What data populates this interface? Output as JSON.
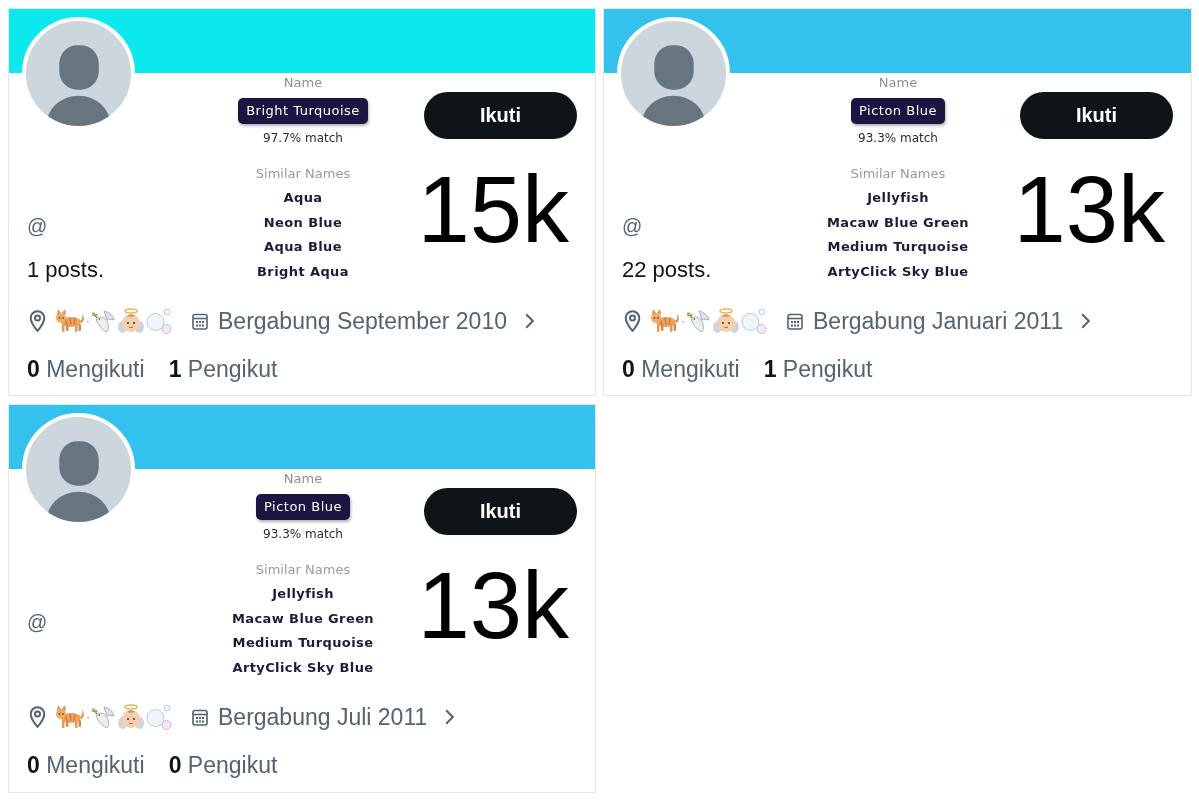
{
  "profiles": [
    {
      "color": "#0be9ef",
      "color_match": {
        "label": "Name",
        "name": "Bright Turquoise",
        "match": "97.7% match",
        "similar_label": "Similar Names",
        "similar": [
          "Aqua",
          "Neon Blue",
          "Aqua Blue",
          "Bright Aqua"
        ]
      },
      "follow_button": "Ikuti",
      "big_number": "15k",
      "handle": "@",
      "posts": "1 posts.",
      "location": {
        "separator": "·"
      },
      "joined": "Bergabung September 2010",
      "following": {
        "count": "0",
        "label": "Mengikuti"
      },
      "followers": {
        "count": "1",
        "label": "Pengikut"
      }
    },
    {
      "color": "#33c1ee",
      "color_match": {
        "label": "Name",
        "name": "Picton Blue",
        "match": "93.3% match",
        "similar_label": "Similar Names",
        "similar": [
          "Jellyfish",
          "Macaw Blue Green",
          "Medium Turquoise",
          "ArtyClick Sky Blue"
        ]
      },
      "follow_button": "Ikuti",
      "big_number": "13k",
      "handle": "@",
      "posts": "22 posts.",
      "location": {
        "separator": "·"
      },
      "joined": "Bergabung Januari 2011",
      "following": {
        "count": "0",
        "label": "Mengikuti"
      },
      "followers": {
        "count": "1",
        "label": "Pengikut"
      }
    },
    {
      "color": "#33c1ee",
      "color_match": {
        "label": "Name",
        "name": "Picton Blue",
        "match": "93.3% match",
        "similar_label": "Similar Names",
        "similar": [
          "Jellyfish",
          "Macaw Blue Green",
          "Medium Turquoise",
          "ArtyClick Sky Blue"
        ]
      },
      "follow_button": "Ikuti",
      "big_number": "13k",
      "handle": "@",
      "location": {
        "separator": "·"
      },
      "joined": "Bergabung Juli 2011",
      "following": {
        "count": "0",
        "label": "Mengikuti"
      },
      "followers": {
        "count": "0",
        "label": "Pengikut"
      }
    }
  ]
}
